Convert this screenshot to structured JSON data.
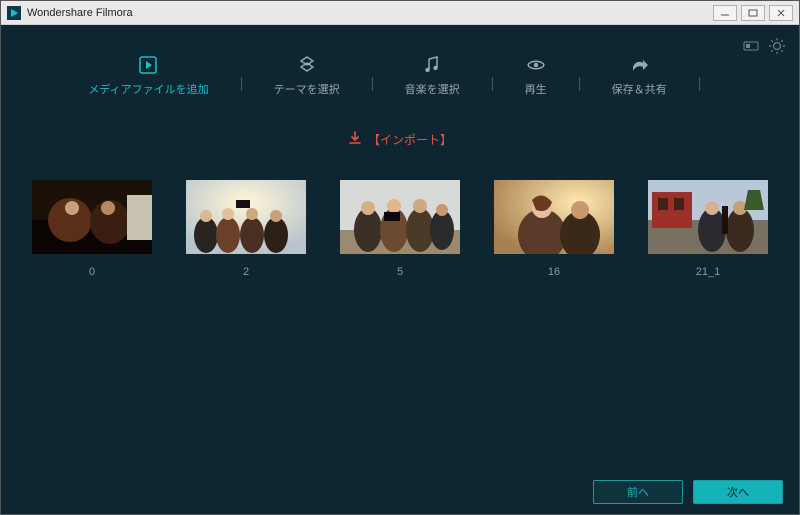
{
  "titlebar": {
    "title": "Wondershare Filmora"
  },
  "steps": [
    {
      "label": "メディアファイルを追加",
      "icon": "media"
    },
    {
      "label": "テーマを選択",
      "icon": "theme"
    },
    {
      "label": "音楽を選択",
      "icon": "music"
    },
    {
      "label": "再生",
      "icon": "play"
    },
    {
      "label": "保存＆共有",
      "icon": "share"
    }
  ],
  "import": {
    "label": "【インポート】"
  },
  "thumbs": [
    {
      "label": "0"
    },
    {
      "label": "2"
    },
    {
      "label": "5"
    },
    {
      "label": "16"
    },
    {
      "label": "21_1"
    }
  ],
  "footer": {
    "prev": "前へ",
    "next": "次へ"
  }
}
